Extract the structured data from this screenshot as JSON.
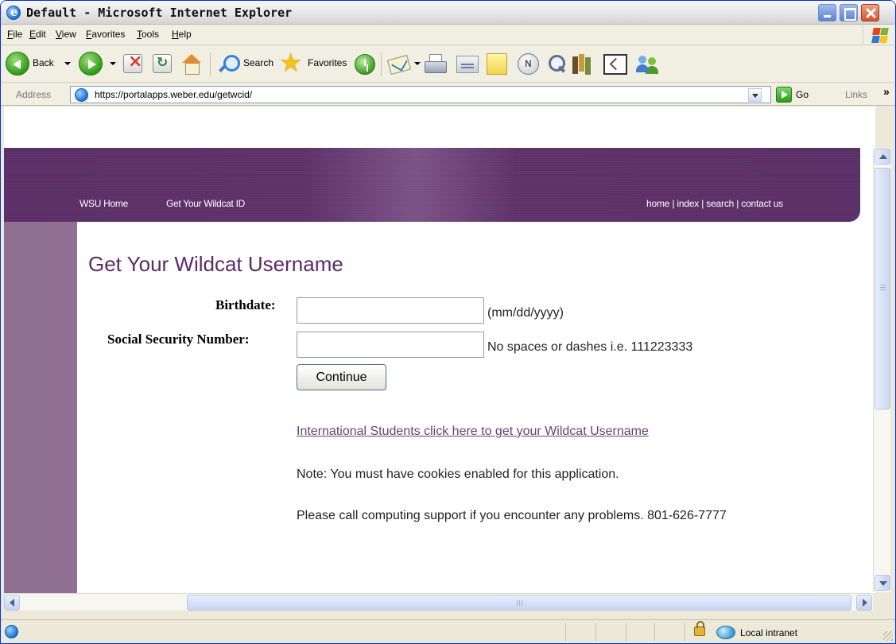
{
  "window": {
    "title": "Default - Microsoft Internet Explorer"
  },
  "menu": {
    "items": [
      "File",
      "Edit",
      "View",
      "Favorites",
      "Tools",
      "Help"
    ]
  },
  "toolbar": {
    "back_label": "Back",
    "search_label": "Search",
    "favorites_label": "Favorites"
  },
  "address": {
    "label": "Address",
    "url": "https://portalapps.weber.edu/getwcid/",
    "go_label": "Go",
    "links_label": "Links",
    "links_chevron": "»"
  },
  "banner": {
    "nav": [
      "WSU Home",
      "Get Your Wildcat ID"
    ],
    "right_links": "home | index | search | contact us"
  },
  "page": {
    "title": "Get Your Wildcat Username",
    "birthdate_label": "Birthdate:",
    "birthdate_value": "",
    "birthdate_hint": "(mm/dd/yyyy)",
    "ssn_label": "Social Security Number:",
    "ssn_value": "",
    "ssn_hint": "No spaces or dashes i.e. 111223333",
    "continue_label": "Continue",
    "intl_link": "International Students click here to get your Wildcat Username",
    "cookie_note": "Note: You must have cookies enabled for this application.",
    "support_note": "Please call computing support if you encounter any problems. 801-626-7777"
  },
  "status": {
    "zone_label": "Local intranet"
  },
  "colors": {
    "banner": "#5a2e66",
    "sidebar": "#8f6f92",
    "title": "#5b2b66",
    "link": "#6b3f78"
  }
}
